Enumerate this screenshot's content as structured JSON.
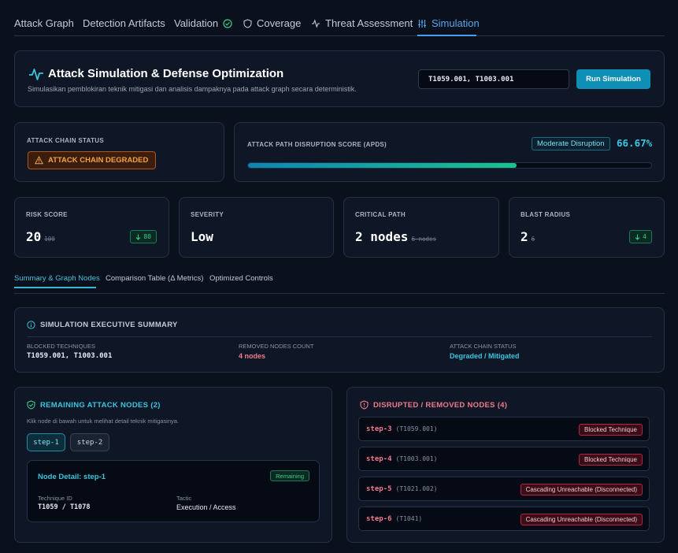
{
  "tabs": [
    {
      "label": "Attack Graph"
    },
    {
      "label": "Detection Artifacts"
    },
    {
      "label": "Validation"
    },
    {
      "label": "Coverage"
    },
    {
      "label": "Threat Assessment"
    },
    {
      "label": "Simulation",
      "active": true
    }
  ],
  "header": {
    "title": "Attack Simulation & Defense Optimization",
    "subtitle": "Simulasikan pemblokiran teknik mitigasi dan analisis dampaknya pada attack graph secara deterministik.",
    "input_value": "T1059.001, T1003.001",
    "run_label": "Run Simulation"
  },
  "chain_status": {
    "label": "ATTACK CHAIN STATUS",
    "badge": "ATTACK CHAIN DEGRADED"
  },
  "apds": {
    "label": "ATTACK PATH DISRUPTION SCORE (APDS)",
    "badge": "Moderate Disruption",
    "score_text": "66.67%",
    "score": 66.67
  },
  "metrics": [
    {
      "label": "RISK SCORE",
      "value": "20",
      "old": "100",
      "delta": "80"
    },
    {
      "label": "SEVERITY",
      "value": "Low"
    },
    {
      "label": "CRITICAL PATH",
      "value": "2 nodes",
      "old": "6 nodes"
    },
    {
      "label": "BLAST RADIUS",
      "value": "2",
      "old": "6",
      "delta": "4"
    }
  ],
  "subtabs": [
    {
      "label": "Summary & Graph Nodes",
      "active": true
    },
    {
      "label": "Comparison Table (Δ Metrics)"
    },
    {
      "label": "Optimized Controls"
    }
  ],
  "summary": {
    "title": "SIMULATION EXECUTIVE SUMMARY",
    "cols": [
      {
        "label": "BLOCKED TECHNIQUES",
        "value": "T1059.001, T1003.001"
      },
      {
        "label": "REMOVED NODES COUNT",
        "value": "4 nodes"
      },
      {
        "label": "ATTACK CHAIN STATUS",
        "value": "Degraded / Mitigated"
      }
    ]
  },
  "remaining": {
    "title": "REMAINING ATTACK NODES (2)",
    "hint": "Klik node di bawah untuk melihat detail teknik mitigasinya.",
    "steps": [
      "step-1",
      "step-2"
    ],
    "detail": {
      "title": "Node Detail: step-1",
      "badge": "Remaining",
      "technique_label": "Technique ID",
      "technique_value": "T1059 / T1078",
      "tactic_label": "Tactic",
      "tactic_value": "Execution / Access"
    }
  },
  "removed": {
    "title": "DISRUPTED / REMOVED NODES (4)",
    "rows": [
      {
        "step": "step-3",
        "tech": "(T1059.001)",
        "badge": "Blocked Technique"
      },
      {
        "step": "step-4",
        "tech": "(T1003.001)",
        "badge": "Blocked Technique"
      },
      {
        "step": "step-5",
        "tech": "(T1021.002)",
        "badge": "Cascading Unreachable (Disconnected)"
      },
      {
        "step": "step-6",
        "tech": "(T1041)",
        "badge": "Cascading Unreachable (Disconnected)"
      }
    ]
  },
  "colors": {
    "accent": "#0d8fb6",
    "cyan": "#39c6dd",
    "success": "#35cf8c",
    "danger": "#f07a8c",
    "warning": "#f5a23e"
  }
}
